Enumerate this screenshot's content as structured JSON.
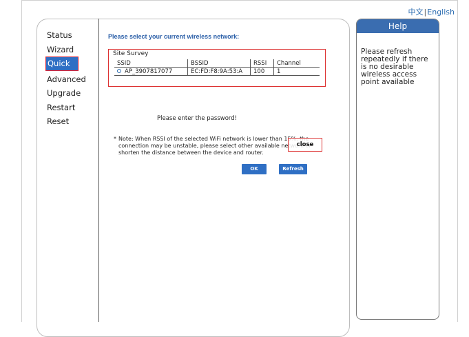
{
  "language": {
    "chinese": "中文",
    "separator": "|",
    "english": "English"
  },
  "nav": {
    "items": [
      {
        "label": "Status"
      },
      {
        "label": "Wizard"
      },
      {
        "label": "Quick Set"
      },
      {
        "label": "Advanced"
      },
      {
        "label": "Upgrade"
      },
      {
        "label": "Restart"
      },
      {
        "label": "Reset"
      }
    ],
    "active": "Quick Set"
  },
  "main": {
    "heading": "Please select your current wireless network:",
    "site_survey": {
      "title": "Site Survey",
      "columns": [
        "SSID",
        "BSSID",
        "RSSI",
        "Channel"
      ],
      "rows": [
        {
          "ssid": "AP_3907817077",
          "bssid": "EC:FD:F8:9A:53:A",
          "rssi": "100",
          "channel": "1"
        }
      ]
    },
    "password_prompt": "Please enter the password!",
    "note": {
      "star": "*",
      "line1": "Note: When RSSI of the selected WiFi network is lower than 15%, the",
      "line2": "connection may be unstable, please select other available network or",
      "line3": "shorten the distance between the device and router."
    },
    "close_label": "close",
    "ok_label": "OK",
    "refresh_label": "Refresh"
  },
  "help": {
    "title": "Help",
    "text": "Please refresh repeatedly if there is no desirable wireless access point available"
  },
  "colors": {
    "accent": "#2f6fc4",
    "highlight": "#d33333",
    "heading": "#2b5fa8"
  }
}
